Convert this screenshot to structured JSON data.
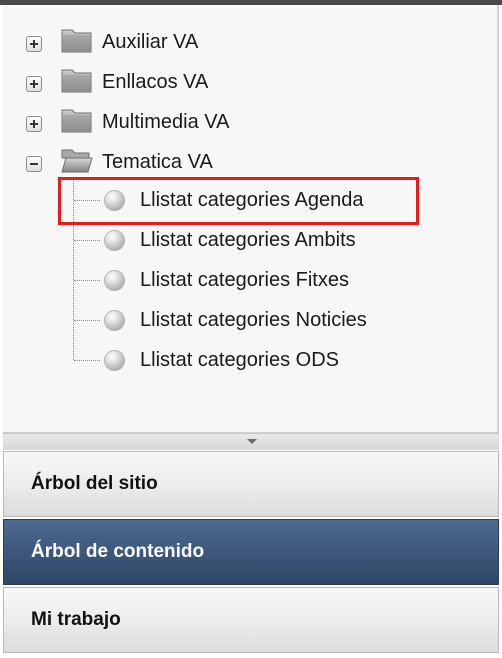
{
  "tree": {
    "folders": [
      {
        "label": "Auxiliar VA",
        "state": "collapsed"
      },
      {
        "label": "Enllacos VA",
        "state": "collapsed"
      },
      {
        "label": "Multimedia VA",
        "state": "collapsed"
      },
      {
        "label": "Tematica VA",
        "state": "expanded"
      }
    ],
    "children": [
      {
        "label": "Llistat categories Agenda",
        "highlighted": true
      },
      {
        "label": "Llistat categories Ambits"
      },
      {
        "label": "Llistat categories Fitxes"
      },
      {
        "label": "Llistat categories Noticies"
      },
      {
        "label": "Llistat categories ODS"
      }
    ]
  },
  "accordion": [
    {
      "label": "Árbol del sitio",
      "active": false
    },
    {
      "label": "Árbol de contenido",
      "active": true
    },
    {
      "label": "Mi trabajo",
      "active": false
    }
  ],
  "colors": {
    "highlight": "#e41e1e",
    "active_tab": "#3b5679"
  }
}
